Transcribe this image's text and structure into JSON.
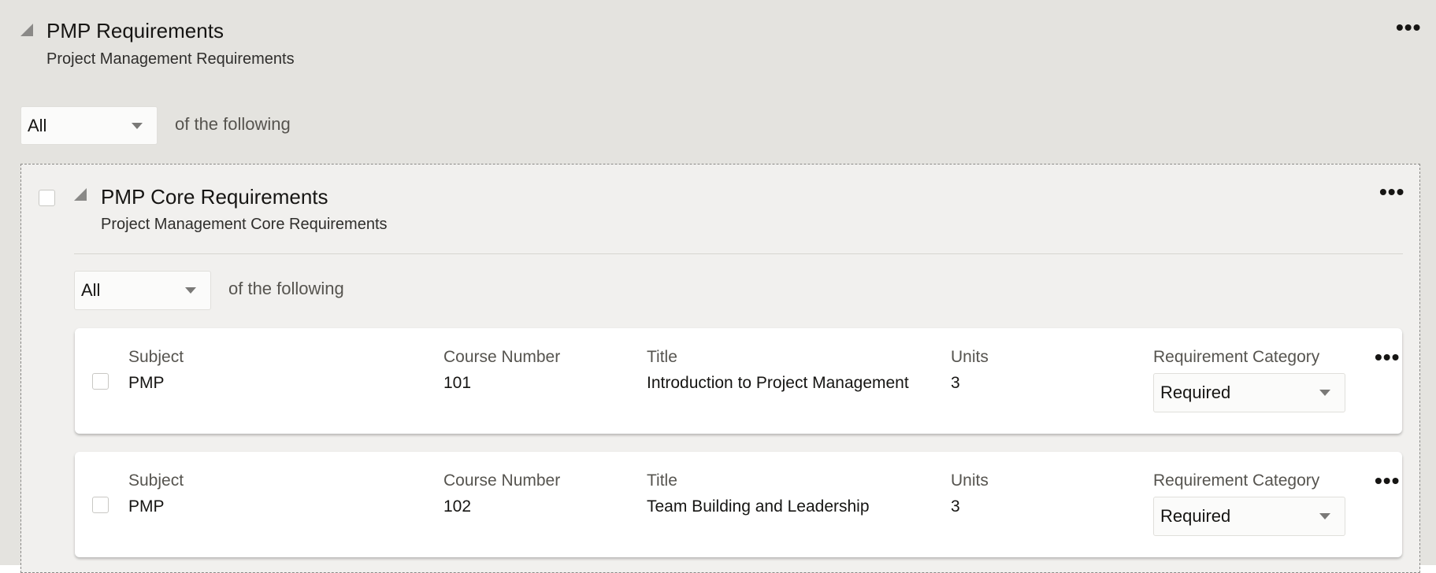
{
  "section": {
    "title": "PMP Requirements",
    "subtitle": "Project Management Requirements",
    "condition": "All",
    "condition_suffix": "of the following"
  },
  "group": {
    "title": "PMP Core Requirements",
    "subtitle": "Project Management Core Requirements",
    "condition": "All",
    "condition_suffix": "of the following"
  },
  "columns": {
    "subject": "Subject",
    "course_number": "Course Number",
    "title": "Title",
    "units": "Units",
    "category": "Requirement Category"
  },
  "courses": [
    {
      "subject": "PMP",
      "course_number": "101",
      "title": "Introduction to Project Management",
      "units": "3",
      "category": "Required"
    },
    {
      "subject": "PMP",
      "course_number": "102",
      "title": "Team Building and Leadership",
      "units": "3",
      "category": "Required"
    }
  ],
  "more_label": "•••"
}
